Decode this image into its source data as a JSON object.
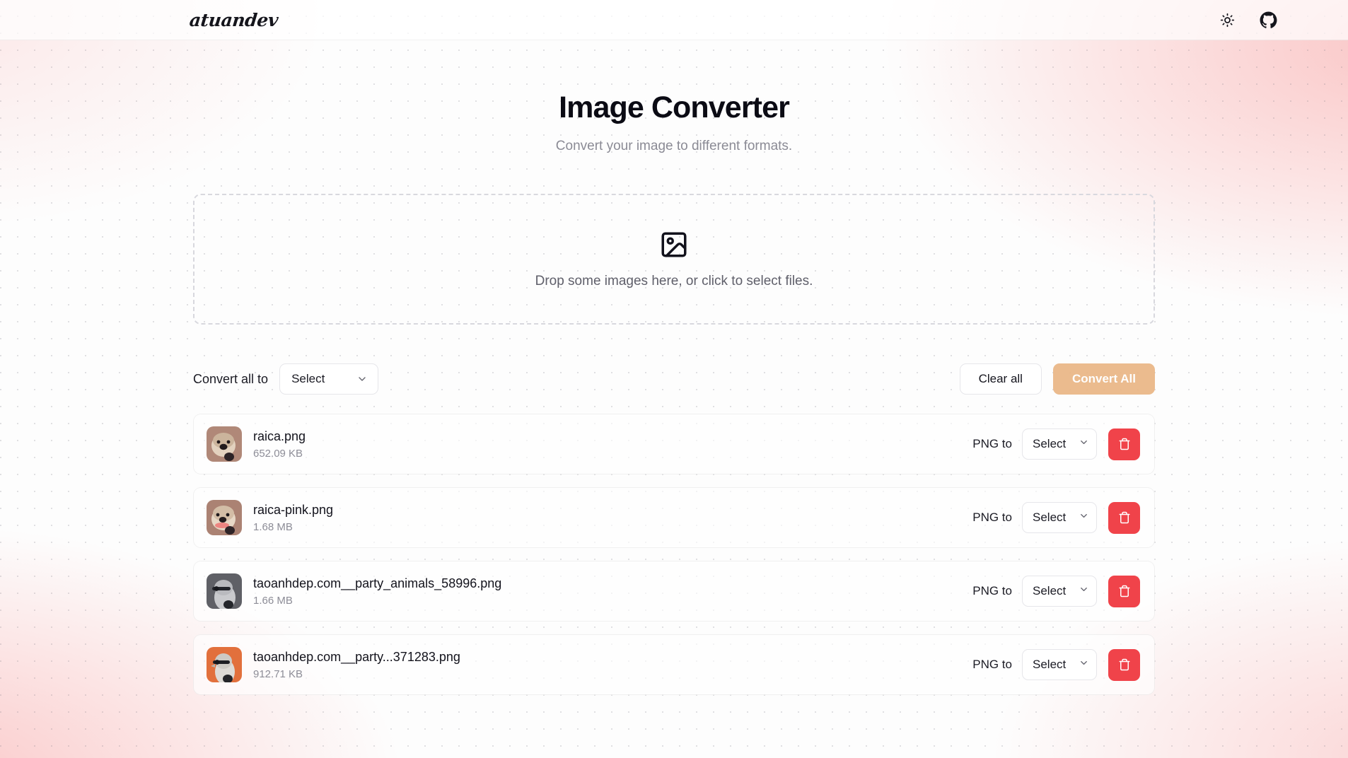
{
  "header": {
    "brand": "atuandev",
    "theme_toggle_icon": "sun-icon",
    "github_icon": "github-icon"
  },
  "hero": {
    "title": "Image Converter",
    "subtitle": "Convert your image to different formats."
  },
  "dropzone": {
    "icon": "image-icon",
    "text": "Drop some images here, or click to select files."
  },
  "controls": {
    "convert_all_label": "Convert all to",
    "select_placeholder": "Select",
    "clear_all_label": "Clear all",
    "convert_all_button": "Convert All",
    "accent_color": "#eab685",
    "delete_color": "#f0434a"
  },
  "files": [
    {
      "name": "raica.png",
      "size": "652.09 KB",
      "source_format_label": "PNG to",
      "target_format": "Select",
      "thumb": "otter-brown",
      "delete_icon": "trash-icon"
    },
    {
      "name": "raica-pink.png",
      "size": "1.68 MB",
      "source_format_label": "PNG to",
      "target_format": "Select",
      "thumb": "otter-pink",
      "delete_icon": "trash-icon"
    },
    {
      "name": "taoanhdep.com__party_animals_58996.png",
      "size": "1.66 MB",
      "source_format_label": "PNG to",
      "target_format": "Select",
      "thumb": "bird-gray",
      "delete_icon": "trash-icon"
    },
    {
      "name": "taoanhdep.com__party...371283.png",
      "size": "912.71 KB",
      "source_format_label": "PNG to",
      "target_format": "Select",
      "thumb": "bird-orange",
      "delete_icon": "trash-icon"
    }
  ]
}
